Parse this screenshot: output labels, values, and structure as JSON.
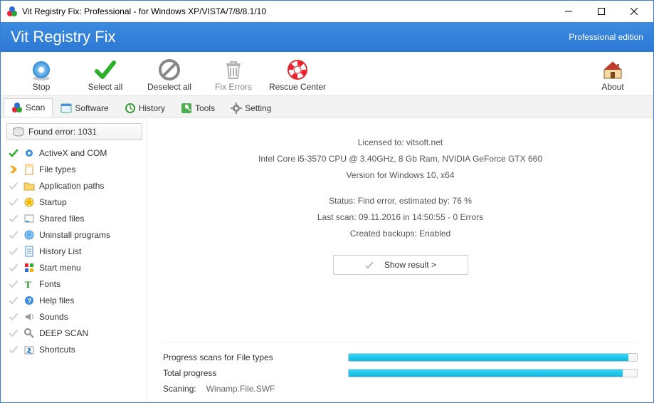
{
  "window": {
    "title": "Vit Registry Fix: Professional - for Windows XP/VISTA/7/8/8.1/10"
  },
  "header": {
    "app_title": "Vit Registry Fix",
    "edition": "Professional edition"
  },
  "toolbar": {
    "stop": "Stop",
    "select_all": "Select all",
    "deselect_all": "Deselect all",
    "fix_errors": "Fix Errors",
    "rescue_center": "Rescue Center",
    "about": "About"
  },
  "tabs": {
    "scan": "Scan",
    "software": "Software",
    "history": "History",
    "tools": "Tools",
    "setting": "Setting"
  },
  "sidebar": {
    "found_label": "Found error: 1031",
    "items": [
      {
        "label": "ActiveX and COM",
        "state": "done",
        "icon": "gear"
      },
      {
        "label": "File types",
        "state": "current",
        "icon": "filetype"
      },
      {
        "label": "Application paths",
        "state": "pending",
        "icon": "folder"
      },
      {
        "label": "Startup",
        "state": "pending",
        "icon": "startup"
      },
      {
        "label": "Shared files",
        "state": "pending",
        "icon": "shared"
      },
      {
        "label": "Uninstall programs",
        "state": "pending",
        "icon": "globe"
      },
      {
        "label": "History List",
        "state": "pending",
        "icon": "historylist"
      },
      {
        "label": "Start menu",
        "state": "pending",
        "icon": "startmenu"
      },
      {
        "label": "Fonts",
        "state": "pending",
        "icon": "fonts"
      },
      {
        "label": "Help files",
        "state": "pending",
        "icon": "help"
      },
      {
        "label": "Sounds",
        "state": "pending",
        "icon": "sounds"
      },
      {
        "label": "DEEP SCAN",
        "state": "pending",
        "icon": "deepscan"
      },
      {
        "label": "Shortcuts",
        "state": "pending",
        "icon": "shortcuts"
      }
    ]
  },
  "info": {
    "licensed": "Licensed to: vitsoft.net",
    "hardware": "Intel Core i5-3570 CPU @ 3.40GHz, 8 Gb Ram, NVIDIA GeForce GTX 660",
    "version": "Version for Windows 10, x64",
    "status": "Status: Find error, estimated by: 76 %",
    "last_scan": "Last scan: 09.11.2016 in 14:50:55 - 0 Errors",
    "backups": "Created backups: Enabled",
    "show_result": "Show result >"
  },
  "progress": {
    "row1_label": "Progress scans for File types",
    "row2_label": "Total progress",
    "scanning_label": "Scaning:",
    "scanning_file": "Winamp.File.SWF",
    "file_types_percent": 97,
    "total_percent": 95
  }
}
